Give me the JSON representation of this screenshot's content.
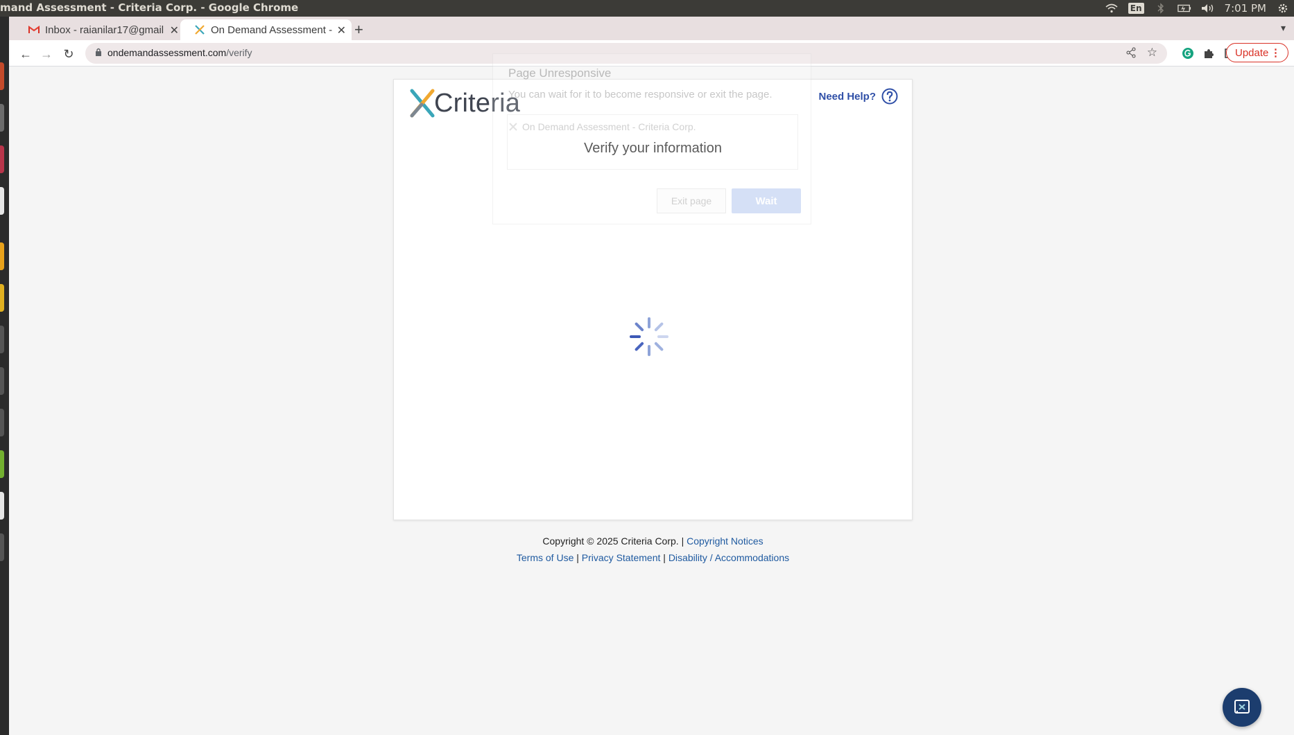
{
  "os": {
    "window_title": "mand Assessment - Criteria Corp. - Google Chrome",
    "lang": "En",
    "clock": "7:01 PM"
  },
  "browser": {
    "tabs": [
      {
        "title": "Inbox - raianilar17@gmail",
        "favicon": "gmail-icon"
      },
      {
        "title": "On Demand Assessment - Criteria",
        "favicon": "criteria-icon"
      }
    ],
    "url_domain": "ondemandassessment.com",
    "url_path": "/verify",
    "update_label": "Update"
  },
  "page": {
    "brand": "Criteria",
    "help_label": "Need Help?",
    "title": "Verify your information"
  },
  "dialog": {
    "title": "Page Unresponsive",
    "message": "You can wait for it to become responsive or exit the page.",
    "page_name": "On Demand Assessment - Criteria Corp.",
    "exit_label": "Exit page",
    "wait_label": "Wait"
  },
  "footer": {
    "copyright": "Copyright © 2025 Criteria Corp. |",
    "copyright_link": "Copyright Notices",
    "terms": "Terms of Use",
    "sep1": "|",
    "privacy": "Privacy Statement",
    "sep2": "|",
    "disability": "Disability / Accommodations"
  },
  "colors": {
    "accent": "#2f4fa7",
    "update_red": "#d93025",
    "chat_bg": "#1c3d6e"
  }
}
